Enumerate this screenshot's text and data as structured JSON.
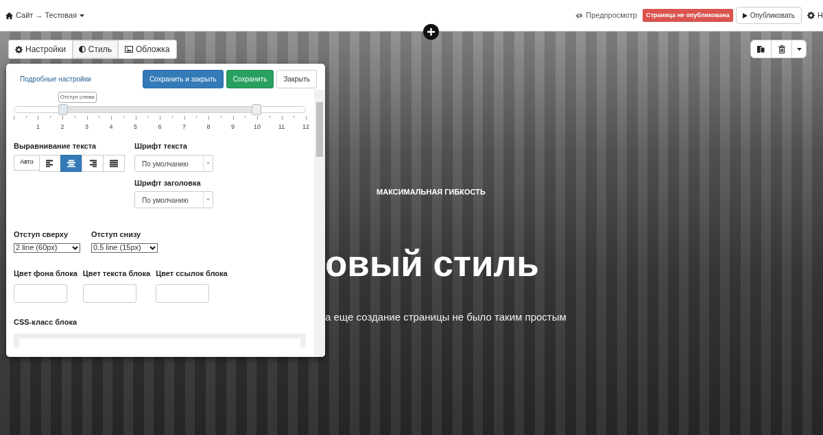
{
  "header": {
    "breadcrumb": "Сайт → Тестовая",
    "preview": "Предпросмотр",
    "status_badge": "Страница не опубликована",
    "publish": "Опубликовать",
    "settings_cut": "Н"
  },
  "block_tabs": [
    {
      "label": "Настройки",
      "kind": "gear",
      "selected": false
    },
    {
      "label": "Стиль",
      "kind": "contrast",
      "selected": true
    },
    {
      "label": "Обложка",
      "kind": "image",
      "selected": false
    }
  ],
  "panel": {
    "link": "Подробные настройки",
    "buttons": [
      {
        "label": "Сохранить и закрыть",
        "kind": "primary"
      },
      {
        "label": "Сохранить",
        "kind": "success"
      },
      {
        "label": "Закрыть",
        "kind": "default"
      }
    ],
    "slider": {
      "tooltip": "Отступ слева",
      "ticks": [
        "1",
        "2",
        "3",
        "4",
        "5",
        "6",
        "7",
        "8",
        "9",
        "10",
        "11",
        "12"
      ],
      "handles": [
        {
          "level": 0.1667
        },
        {
          "level": 0.8333
        }
      ]
    },
    "text_align": {
      "label": "Выравнивание текста",
      "options": [
        {
          "kind": "auto",
          "label": "Авто",
          "selected": false
        },
        {
          "kind": "left",
          "selected": false
        },
        {
          "kind": "center",
          "selected": true
        },
        {
          "kind": "right",
          "selected": false
        },
        {
          "kind": "justify",
          "selected": false
        }
      ]
    },
    "font_text": {
      "label": "Шрифт текста",
      "value": "По умолчанию"
    },
    "font_heading": {
      "label": "Шрифт заголовка",
      "value": "По умолчанию"
    },
    "padding_top": {
      "label": "Отступ сверху",
      "value": "2 line (60px)"
    },
    "padding_bottom": {
      "label": "Отступ снизу",
      "value": "0.5 line (15px)"
    },
    "colors": [
      {
        "label": "Цвет фона блока"
      },
      {
        "label": "Цвет текста блока"
      },
      {
        "label": "Цвет ссылок блока"
      }
    ],
    "css_class": {
      "label": "CSS-класс блока"
    }
  },
  "hero": {
    "eyebrow": "МАКСИМАЛЬНАЯ ГИБКОСТЬ",
    "title": "овый стиль",
    "subtitle": "а еще создание страницы не было таким простым"
  }
}
